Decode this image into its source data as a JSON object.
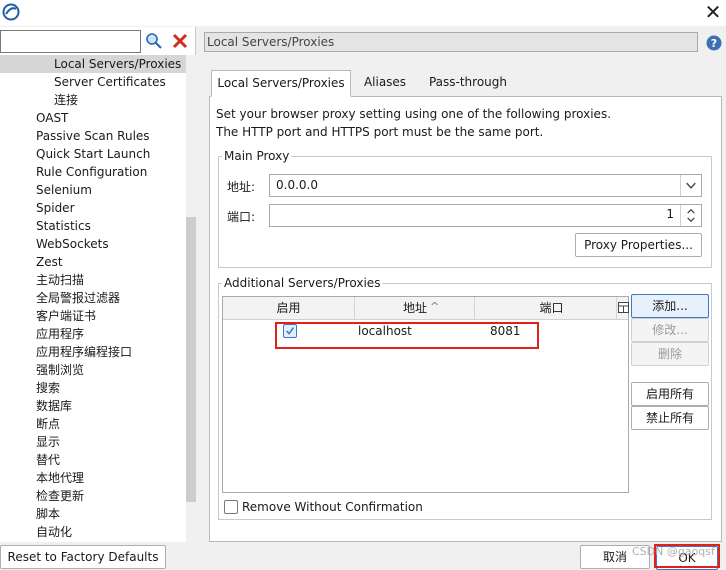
{
  "titlebar": {
    "close_glyph": "✕"
  },
  "search": {
    "value": "",
    "placeholder": ""
  },
  "tree": {
    "items": [
      "Local Servers/Proxies",
      "Server Certificates",
      "连接",
      "OAST",
      "Passive Scan Rules",
      "Quick Start Launch",
      "Rule Configuration",
      "Selenium",
      "Spider",
      "Statistics",
      "WebSockets",
      "Zest",
      "主动扫描",
      "全局警报过滤器",
      "客户端证书",
      "应用程序",
      "应用程序编程接口",
      "强制浏览",
      "搜索",
      "数据库",
      "断点",
      "显示",
      "替代",
      "本地代理",
      "检查更新",
      "脚本",
      "自动化"
    ]
  },
  "panel": {
    "title": "Local Servers/Proxies",
    "tabs": [
      "Local Servers/Proxies",
      "Aliases",
      "Pass-through"
    ],
    "description_line1": "Set your browser proxy setting using one of the following proxies.",
    "description_line2": "The HTTP port and HTTPS port must be the same port.",
    "main_proxy": {
      "title": "Main Proxy",
      "address_label": "地址:",
      "address_value": "0.0.0.0",
      "port_label": "端口:",
      "port_value": "1",
      "properties_button": "Proxy Properties..."
    },
    "additional": {
      "title": "Additional Servers/Proxies",
      "columns": [
        "启用",
        "地址",
        "端口"
      ],
      "sort_indicator": "^",
      "rows": [
        {
          "enabled": true,
          "address": "localhost",
          "port": "8081"
        }
      ],
      "buttons": {
        "add": "添加...",
        "edit": "修改...",
        "delete": "删除",
        "enable_all": "启用所有",
        "disable_all": "禁止所有"
      },
      "remove_without_confirmation": "Remove Without Confirmation"
    }
  },
  "footer": {
    "reset_button": "Reset to Factory Defaults",
    "cancel_button": "取消",
    "ok_button": "OK",
    "watermark": "CSDN @gaoqsf"
  },
  "colors": {
    "highlight_red": "#e0201b",
    "accent_blue": "#3b78c6"
  }
}
